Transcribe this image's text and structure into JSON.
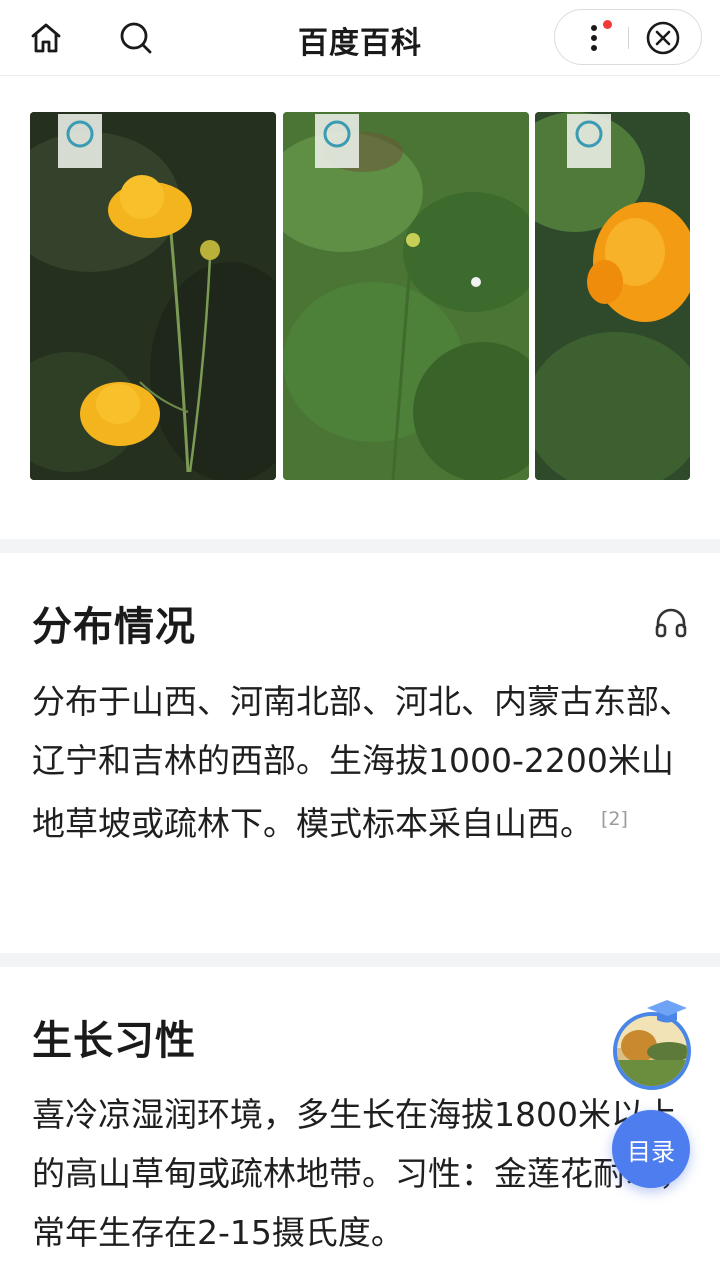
{
  "header": {
    "title": "百度百科",
    "icons": [
      "home-icon",
      "search-icon",
      "more-icon",
      "close-icon"
    ]
  },
  "gallery": {
    "photos": [
      {
        "label": "globeflower-photo-1"
      },
      {
        "label": "globeflower-photo-2"
      },
      {
        "label": "globeflower-photo-3"
      }
    ]
  },
  "distribution": {
    "title": "分布情况",
    "text": "分布于山西、河南北部、河北、内蒙古东部、辽宁和吉林的西部。生海拔1000-2200米山地草坡或疏林下。模式标本采自山西。",
    "ref": "[2]"
  },
  "habit": {
    "title": "生长习性",
    "text": "喜冷凉湿润环境，多生长在海拔1800米以上的高山草甸或疏林地带。习性：金莲花耐寒，常年生存在2-15摄氏度。"
  },
  "floating": {
    "toc_label": "目录"
  },
  "colors": {
    "accent": "#4e7df0",
    "notification": "#f23a3a",
    "separator": "#f3f4f6"
  }
}
